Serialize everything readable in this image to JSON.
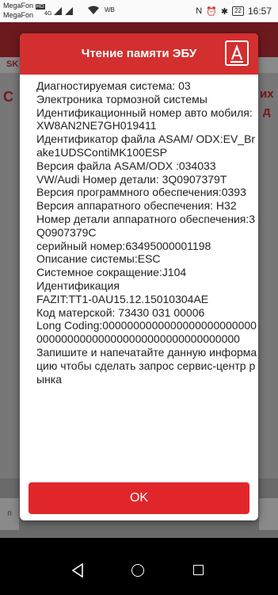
{
  "status_bar": {
    "carrier_1": "MegaFon",
    "carrier_1_badge": "HD",
    "carrier_2": "MegaFon",
    "network": "4G",
    "wb_label": "WB",
    "battery": "22",
    "time": "16:57"
  },
  "background_app": {
    "sub_label": "SK",
    "side_text_right_1": "их",
    "side_text_right_2": "д",
    "side_text_left": "С",
    "bottom_left_label": "п"
  },
  "dialog": {
    "title": "Чтение памяти ЭБУ",
    "logo_icon": "autocom-logo-icon",
    "body_text": "Диагностируемая система: 03\nЭлектроника тормозной системы\nИдентификационный номер авто мобиля:XW8AN2NE7GH019411\nИдентификатор файла ASAM/ ODX:EV_Brake1UDSContiMK100ESP\nВерсия файла ASAM/ODX :034033\nVW/Audi Номер детали: 3Q0907379T\nВерсия программного обеспечения:0393\nВерсия аппаратного обеспечения: H32\nНомер детали аппаратного обеспечения:3Q0907379C\nсерийный номер:63495000001198\nОписание системы:ESC\nСистемное сокращение:J104\nИдентификация\nFAZIT:TT1-0AU15.12.15010304AE\nКод матерской: 73430  031  00006\nLong Coding:0000000000000000000000000000000000000000000000000000000000\nЗапишите и напечатайте данную информацию чтобы сделать запрос сервис-центр рынка",
    "ok_label": "OK"
  },
  "colors": {
    "dialog_header": "#d32f2f",
    "ok_button": "#e0262b"
  }
}
